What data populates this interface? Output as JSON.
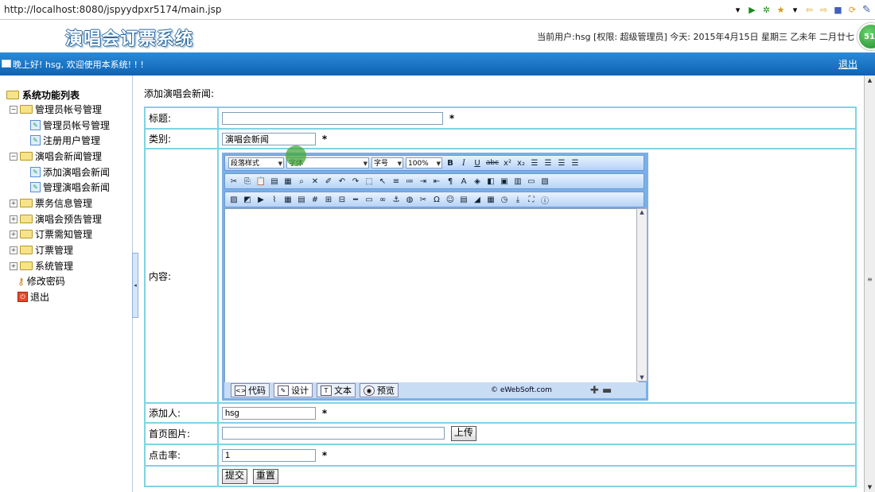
{
  "browser": {
    "url": "http://localhost:8080/jspyydpxr5174/main.jsp"
  },
  "header": {
    "system_title": "演唱会订票系统",
    "user_info": "当前用户:hsg [权限: 超级管理员] 今天:  2015年4月15日 星期三 乙未年 二月廿七",
    "badge": "51"
  },
  "welcome_bar": {
    "greeting": "晚上好! hsg, 欢迎使用本系统! ! !",
    "exit_label": "退出"
  },
  "sidebar": {
    "title": "系统功能列表",
    "items": [
      {
        "label": "管理员帐号管理"
      },
      {
        "label": "管理员帐号管理"
      },
      {
        "label": "注册用户管理"
      },
      {
        "label": "演唱会新闻管理"
      },
      {
        "label": "添加演唱会新闻"
      },
      {
        "label": "管理演唱会新闻"
      },
      {
        "label": "票务信息管理"
      },
      {
        "label": "演唱会预告管理"
      },
      {
        "label": "订票需知管理"
      },
      {
        "label": "订票管理"
      },
      {
        "label": "系统管理"
      },
      {
        "label": "修改密码"
      },
      {
        "label": "退出"
      }
    ]
  },
  "form": {
    "caption": "添加演唱会新闻:",
    "title_label": "标题:",
    "title_value": "",
    "category_label": "类别:",
    "category_value": "演唱会新闻",
    "content_label": "内容:",
    "author_label": "添加人:",
    "author_value": "hsg",
    "image_label": "首页图片:",
    "image_value": "",
    "upload_label": "上传",
    "clicks_label": "点击率:",
    "clicks_value": "1",
    "required_mark": "*",
    "submit_label": "提交",
    "reset_label": "重置"
  },
  "editor": {
    "paragraph_style": "段落样式",
    "font": "字体",
    "font_size": "字号",
    "zoom": "100%",
    "modes": [
      "代码",
      "设计",
      "文本",
      "预览"
    ],
    "brand": "© eWebSoft.com"
  }
}
